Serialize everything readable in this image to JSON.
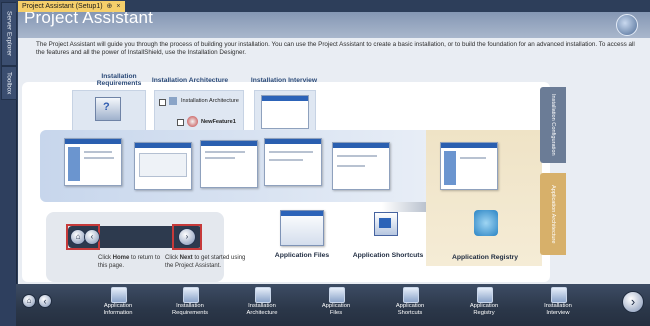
{
  "side_panel": {
    "server_explorer": "Server Explorer",
    "toolbox": "Toolbox"
  },
  "doc_tab": {
    "title": "Project Assistant (Setup1)",
    "pin_icon": "pin-icon",
    "close_icon": "close-icon"
  },
  "page": {
    "title": "Project Assistant",
    "intro": "The Project Assistant will guide you through the process of building your installation. You can use the Project Assistant to create a basic installation, or to build the foundation for an advanced installation. To access all the features and all the power of InstallShield, use the Installation Designer."
  },
  "columns": {
    "requirements": "Installation Requirements",
    "architecture": "Installation Architecture",
    "interview": "Installation Interview"
  },
  "architecture_tree": {
    "root": "Installation Architecture",
    "feature": "NewFeature1"
  },
  "side_cards": {
    "configuration": "Installation Configuration",
    "app_architecture": "Application Architecture"
  },
  "components": {
    "files": "Application Files",
    "shortcuts": "Application Shortcuts",
    "registry": "Application Registry"
  },
  "nav_help": {
    "home_pre": "Click ",
    "home_bold": "Home",
    "home_post": " to return to this page.",
    "next_pre": "Click ",
    "next_bold": "Next",
    "next_post": " to get started using the Project Assistant."
  },
  "bottom_nav": [
    {
      "l1": "Application",
      "l2": "Information"
    },
    {
      "l1": "Installation",
      "l2": "Requirements"
    },
    {
      "l1": "Installation",
      "l2": "Architecture"
    },
    {
      "l1": "Application",
      "l2": "Files"
    },
    {
      "l1": "Application",
      "l2": "Shortcuts"
    },
    {
      "l1": "Application",
      "l2": "Registry"
    },
    {
      "l1": "Installation",
      "l2": "Interview"
    }
  ],
  "icons": {
    "home": "home-icon",
    "back": "back-arrow-icon",
    "next": "next-arrow-icon"
  }
}
